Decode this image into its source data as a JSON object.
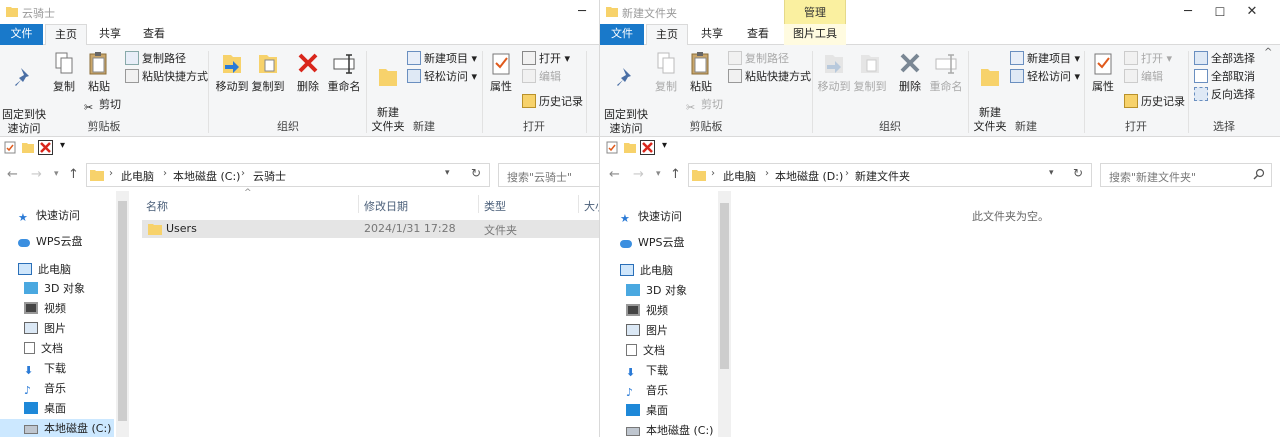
{
  "left": {
    "title": "云骑士",
    "tabs": [
      "文件",
      "主页",
      "共享",
      "查看"
    ],
    "ribbon": {
      "pin": "固定到快\n速访问",
      "copy": "复制",
      "paste": "粘贴",
      "copy_path": "复制路径",
      "paste_shortcut": "粘贴快捷方式",
      "cut": "剪切",
      "move_to": "移动到",
      "copy_to": "复制到",
      "delete": "删除",
      "rename": "重命名",
      "new_item": "新建项目",
      "easy_access": "轻松访问",
      "new_folder": "新建\n文件夹",
      "properties": "属性",
      "open": "打开",
      "edit": "编辑",
      "history": "历史记录",
      "groups": {
        "clipboard": "剪贴板",
        "organize": "组织",
        "new": "新建",
        "open": "打开"
      }
    },
    "address": {
      "crumbs": [
        "此电脑",
        "本地磁盘 (C:)",
        "云骑士"
      ]
    },
    "search_placeholder": "搜索\"云骑士\"",
    "nav": [
      "快速访问",
      "WPS云盘",
      "此电脑",
      "3D 对象",
      "视频",
      "图片",
      "文档",
      "下载",
      "音乐",
      "桌面",
      "本地磁盘 (C:)"
    ],
    "columns": [
      "名称",
      "修改日期",
      "类型",
      "大小"
    ],
    "files": [
      {
        "name": "Users",
        "date": "2024/1/31 17:28",
        "type": "文件夹"
      }
    ]
  },
  "right": {
    "title": "新建文件夹",
    "context_tab": "管理",
    "tabs": [
      "文件",
      "主页",
      "共享",
      "查看",
      "图片工具"
    ],
    "ribbon": {
      "pin": "固定到快\n速访问",
      "copy": "复制",
      "paste": "粘贴",
      "copy_path": "复制路径",
      "paste_shortcut": "粘贴快捷方式",
      "cut": "剪切",
      "move_to": "移动到",
      "copy_to": "复制到",
      "delete": "删除",
      "rename": "重命名",
      "new_item": "新建项目",
      "easy_access": "轻松访问",
      "new_folder": "新建\n文件夹",
      "properties": "属性",
      "open": "打开",
      "edit": "编辑",
      "history": "历史记录",
      "select_all": "全部选择",
      "select_none": "全部取消",
      "invert": "反向选择",
      "groups": {
        "clipboard": "剪贴板",
        "organize": "组织",
        "new": "新建",
        "open": "打开",
        "select": "选择"
      }
    },
    "address": {
      "crumbs": [
        "此电脑",
        "本地磁盘 (D:)",
        "新建文件夹"
      ]
    },
    "search_placeholder": "搜索\"新建文件夹\"",
    "nav": [
      "快速访问",
      "WPS云盘",
      "此电脑",
      "3D 对象",
      "视频",
      "图片",
      "文档",
      "下载",
      "音乐",
      "桌面",
      "本地磁盘 (C:)"
    ],
    "empty_message": "此文件夹为空。"
  },
  "colors": {
    "accent": "#1979ca",
    "selection": "#cce8ff",
    "folder": "#f7d26b",
    "context_tab": "#faf0a0"
  }
}
